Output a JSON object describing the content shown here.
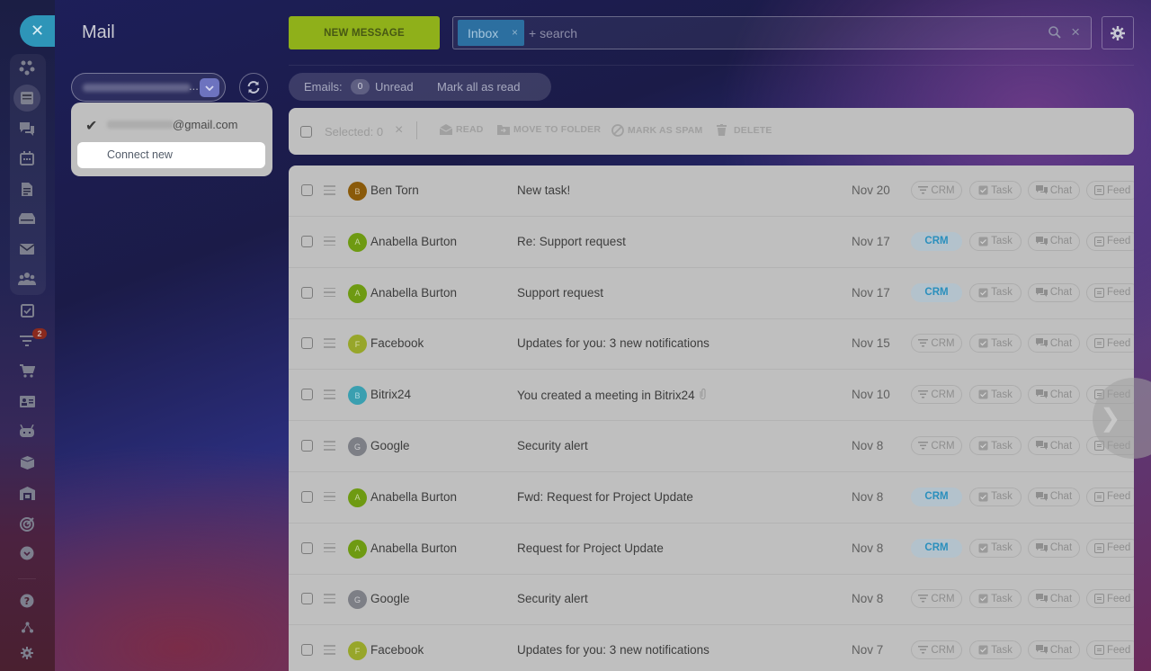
{
  "app": {
    "title": "Mail",
    "close_icon": "close-icon"
  },
  "rail": {
    "items": [
      {
        "icon": "collaboration-icon",
        "active": false
      },
      {
        "icon": "feed-icon",
        "active": true
      },
      {
        "icon": "messenger-icon",
        "active": false
      },
      {
        "icon": "calendar-icon",
        "active": false
      },
      {
        "icon": "documents-icon",
        "active": false
      },
      {
        "icon": "drive-icon",
        "active": false
      },
      {
        "icon": "mail-icon",
        "active": false
      },
      {
        "icon": "groups-icon",
        "active": false
      },
      {
        "icon": "tasks-icon",
        "active": false
      },
      {
        "icon": "crm-funnel-icon",
        "active": false,
        "badge": "2"
      },
      {
        "icon": "store-cart-icon",
        "active": false
      },
      {
        "icon": "contact-card-icon",
        "active": false
      },
      {
        "icon": "robot-icon",
        "active": false
      },
      {
        "icon": "inventory-box-icon",
        "active": false
      },
      {
        "icon": "warehouse-icon",
        "active": false
      },
      {
        "icon": "target-icon",
        "active": false
      },
      {
        "icon": "more-chevron-icon",
        "active": false
      },
      {
        "icon": "help-icon",
        "active": false
      },
      {
        "icon": "structure-icon",
        "active": false
      },
      {
        "icon": "settings-icon",
        "active": false
      }
    ],
    "badge_count": "2"
  },
  "account": {
    "selected_display": "...",
    "dropdown": {
      "current_email_suffix": "@gmail.com",
      "connect_new": "Connect new"
    }
  },
  "toolbar": {
    "new_message": "NEW MESSAGE",
    "search_chip": "Inbox",
    "search_chip_close": "×",
    "search_placeholder": "+ search",
    "search_clear": "×"
  },
  "counters": {
    "label": "Emails:",
    "unread_count": "0",
    "unread_label": "Unread",
    "mark_all": "Mark all as read"
  },
  "actions": {
    "selected_label": "Selected: 0",
    "clear": "×",
    "read": "READ",
    "move": "MOVE TO FOLDER",
    "spam": "MARK AS SPAM",
    "delete": "DELETE"
  },
  "pills": {
    "crm": "CRM",
    "task": "Task",
    "chat": "Chat",
    "feed": "Feed"
  },
  "colors": {
    "accent_green": "#8fb01a",
    "chip_blue": "#2c6fa0",
    "crm_active": "#2a8fbd"
  },
  "messages": [
    {
      "initial": "B",
      "avatar_color": "#8a5a0a",
      "sender": "Ben Torn",
      "subject": "New task!",
      "date": "Nov 20",
      "crm_active": false,
      "attachment": false
    },
    {
      "initial": "A",
      "avatar_color": "#6e9a12",
      "sender": "Anabella Burton",
      "subject": "Re: Support request",
      "date": "Nov 17",
      "crm_active": true,
      "attachment": false
    },
    {
      "initial": "A",
      "avatar_color": "#6e9a12",
      "sender": "Anabella Burton",
      "subject": "Support request",
      "date": "Nov 17",
      "crm_active": true,
      "attachment": false
    },
    {
      "initial": "F",
      "avatar_color": "#97a62a",
      "sender": "Facebook",
      "subject": "Updates for you: 3 new notifications",
      "date": "Nov 15",
      "crm_active": false,
      "attachment": false
    },
    {
      "initial": "B",
      "avatar_color": "#3a9fb0",
      "sender": "Bitrix24",
      "subject": "You created a meeting in Bitrix24",
      "date": "Nov 10",
      "crm_active": false,
      "attachment": true
    },
    {
      "initial": "G",
      "avatar_color": "#7d7f86",
      "sender": "Google",
      "subject": "Security alert",
      "date": "Nov 8",
      "crm_active": false,
      "attachment": false
    },
    {
      "initial": "A",
      "avatar_color": "#6e9a12",
      "sender": "Anabella Burton",
      "subject": "Fwd: Request for Project Update",
      "date": "Nov 8",
      "crm_active": true,
      "attachment": false
    },
    {
      "initial": "A",
      "avatar_color": "#6e9a12",
      "sender": "Anabella Burton",
      "subject": "Request for Project Update",
      "date": "Nov 8",
      "crm_active": true,
      "attachment": false
    },
    {
      "initial": "G",
      "avatar_color": "#7d7f86",
      "sender": "Google",
      "subject": "Security alert",
      "date": "Nov 8",
      "crm_active": false,
      "attachment": false
    },
    {
      "initial": "F",
      "avatar_color": "#97a62a",
      "sender": "Facebook",
      "subject": "Updates for you: 3 new notifications",
      "date": "Nov 7",
      "crm_active": false,
      "attachment": false
    }
  ]
}
